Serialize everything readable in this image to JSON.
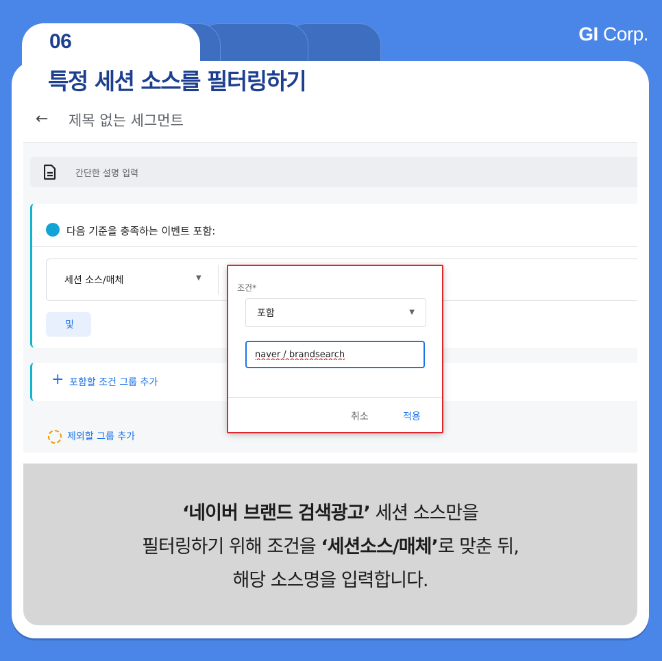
{
  "header": {
    "step_number": "06",
    "title": "특정 세션 소스를 필터링하기",
    "brand_bold": "GI",
    "brand_rest": " Corp."
  },
  "screenshot": {
    "back_icon": "arrow-left-icon",
    "segment_title": "제목 없는 세그먼트",
    "description_placeholder": "간단한 설명 입력",
    "include_condition_label": "다음 기준을 충족하는 이벤트 포함:",
    "field_label": "세션 소스/매체",
    "and_button": "및",
    "add_include_group": "포함할 조건 그룹 추가",
    "add_exclude_group": "제외할 그룹 추가",
    "colors": {
      "accent_blue": "#1a73e8",
      "condition_teal": "#12b5cb",
      "highlight_red": "#e0262b"
    }
  },
  "dialog": {
    "condition_label": "조건*",
    "condition_value": "포함",
    "input_value": "naver / brandsearch",
    "cancel": "취소",
    "apply": "적용"
  },
  "caption": {
    "line1_bold": "‘네이버 브랜드 검색광고’",
    "line1_rest": " 세션 소스만을",
    "line2_start": "필터링하기 위해 조건을 ",
    "line2_bold": "‘세션소스/매체’",
    "line2_end": "로 맞춘 뒤,",
    "line3": "해당 소스명을 입력합니다."
  }
}
